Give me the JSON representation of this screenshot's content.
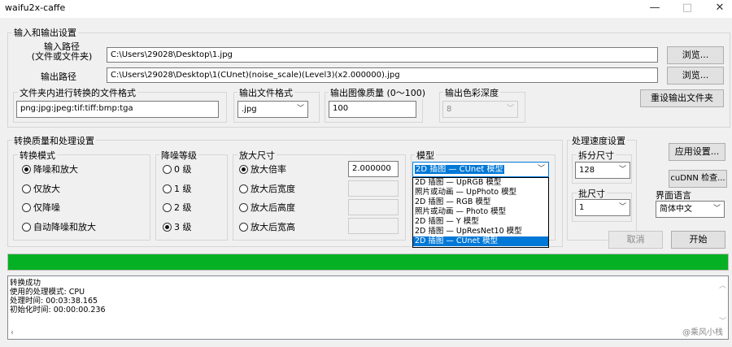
{
  "window": {
    "title": "waifu2x-caffe",
    "minimize": "—",
    "maximize": "□",
    "close": "✕"
  },
  "io": {
    "group_title": "输入和输出设置",
    "input_label_1": "输入路径",
    "input_label_2": "(文件或文件夹)",
    "input_path": "C:\\Users\\29028\\Desktop\\1.jpg",
    "output_label": "输出路径",
    "output_path": "C:\\Users\\29028\\Desktop\\1(CUnet)(noise_scale)(Level3)(x2.000000).jpg",
    "browse_label": "浏览...",
    "browse_label_2": "浏览...",
    "folder_format_title": "文件夹内进行转换的文件格式",
    "folder_format_value": "png:jpg:jpeg:tif:tiff:bmp:tga",
    "output_format_title": "输出文件格式",
    "output_format_value": ".jpg",
    "quality_title": "输出图像质量 (0～100)",
    "quality_value": "100",
    "color_depth_title": "输出色彩深度",
    "color_depth_value": "8",
    "reset_output_button": "重设输出文件夹"
  },
  "conversion": {
    "group_title": "转换质量和处理设置",
    "mode": {
      "title": "转换模式",
      "options": [
        "降噪和放大",
        "仅放大",
        "仅降噪",
        "自动降噪和放大"
      ],
      "selected": 0
    },
    "noise": {
      "title": "降噪等级",
      "options": [
        "0 级",
        "1 级",
        "2 级",
        "3 级"
      ],
      "selected": 3
    },
    "scale": {
      "title": "放大尺寸",
      "options": [
        "放大倍率",
        "放大后宽度",
        "放大后高度",
        "放大后宽高"
      ],
      "selected": 0,
      "ratio_value": "2.000000"
    },
    "model": {
      "title": "模型",
      "selected_value": "2D 插图 — CUnet 模型",
      "options": [
        "2D 插图 — UpRGB 模型",
        "照片或动画 — UpPhoto 模型",
        "2D 插图 — RGB 模型",
        "照片或动画 — Photo 模型",
        "2D 插图 — Y 模型",
        "2D 插图 — UpResNet10 模型",
        "2D 插图 — CUnet 模型"
      ],
      "highlighted": 6
    }
  },
  "speed": {
    "group_title": "处理速度设置",
    "split_title": "拆分尺寸",
    "split_value": "128",
    "batch_title": "批尺寸",
    "batch_value": "1"
  },
  "right": {
    "apply_button": "应用设置...",
    "cudnn_button": "cuDNN 检查...",
    "lang_title": "界面语言",
    "lang_value": "简体中文",
    "cancel_button": "取消",
    "start_button": "开始"
  },
  "progress": {
    "fraction": 1.0,
    "color": "#06b025"
  },
  "log": {
    "lines": [
      "转换成功",
      "使用的处理模式: CPU",
      "处理时间: 00:03:38.165",
      "初始化时间: 00:00:00.236"
    ]
  },
  "watermark": "@乘风小栈"
}
